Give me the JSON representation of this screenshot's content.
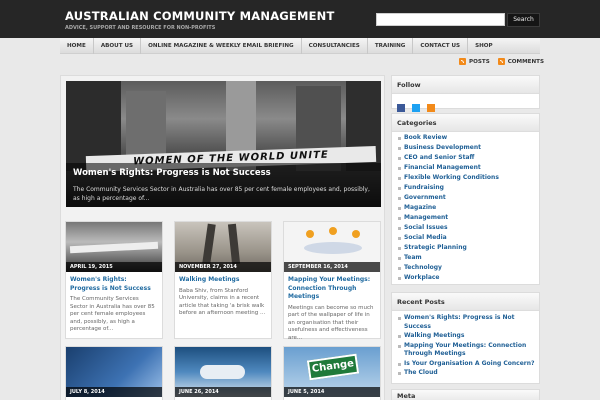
{
  "site": {
    "title": "AUSTRALIAN COMMUNITY MANAGEMENT",
    "description": "ADVICE, SUPPORT AND RESOURCE FOR NON-PROFITS"
  },
  "search": {
    "placeholder": "",
    "button": "Search"
  },
  "nav": {
    "items": [
      "HOME",
      "ABOUT US",
      "ONLINE MAGAZINE & WEEKLY EMAIL BRIEFING",
      "CONSULTANCIES",
      "TRAINING",
      "CONTACT US",
      "SHOP"
    ]
  },
  "feeds": {
    "posts": "POSTS",
    "comments": "COMMENTS"
  },
  "featured": {
    "banner": "WOMEN OF THE WORLD UNITE",
    "title": "Women's Rights: Progress is Not Success",
    "excerpt": "The Community Services Sector in Australia has over 85 per cent female employees and, possibly, as high a percentage of..."
  },
  "posts": [
    {
      "date": "APRIL 19, 2015",
      "title": "Women's Rights: Progress is Not Success",
      "excerpt": "The Community Services Sector in Australia has over 85 per cent female employees and, possibly, as high a percentage of..."
    },
    {
      "date": "NOVEMBER 27, 2014",
      "title": "Walking Meetings",
      "excerpt": "Baba Shiv, from Stanford University, claims in a recent article that taking 'a brisk walk before an afternoon meeting ..."
    },
    {
      "date": "SEPTEMBER 16, 2014",
      "title": "Mapping Your Meetings: Connection Through Meetings",
      "excerpt": "Meetings can become so much part of the wallpaper of life in an organisation that their usefulness and effectiveness are..."
    },
    {
      "date": "JULY 8, 2014",
      "title": "",
      "excerpt": ""
    },
    {
      "date": "JUNE 26, 2014",
      "title": "",
      "excerpt": ""
    },
    {
      "date": "JUNE 5, 2014",
      "title": "",
      "excerpt": "",
      "image_text": "Change"
    }
  ],
  "sidebar": {
    "follow": {
      "heading": "Follow",
      "icons": [
        "facebook-icon",
        "twitter-icon",
        "rss-icon"
      ]
    },
    "categories": {
      "heading": "Categories",
      "items": [
        "Book Review",
        "Business Development",
        "CEO and Senior Staff",
        "Financial Management",
        "Flexible Working Conditions",
        "Fundraising",
        "Government",
        "Magazine",
        "Management",
        "Social Issues",
        "Social Media",
        "Strategic Planning",
        "Team",
        "Technology",
        "Workplace"
      ]
    },
    "recent": {
      "heading": "Recent Posts",
      "items": [
        "Women's Rights: Progress is Not Success",
        "Walking Meetings",
        "Mapping Your Meetings: Connection Through Meetings",
        "Is Your Organisation A Going Concern?",
        "The Cloud"
      ]
    },
    "meta": {
      "heading": "Meta"
    }
  },
  "colors": {
    "header": "#262626",
    "link": "#1f5f95",
    "rss": "#f28a1a"
  }
}
